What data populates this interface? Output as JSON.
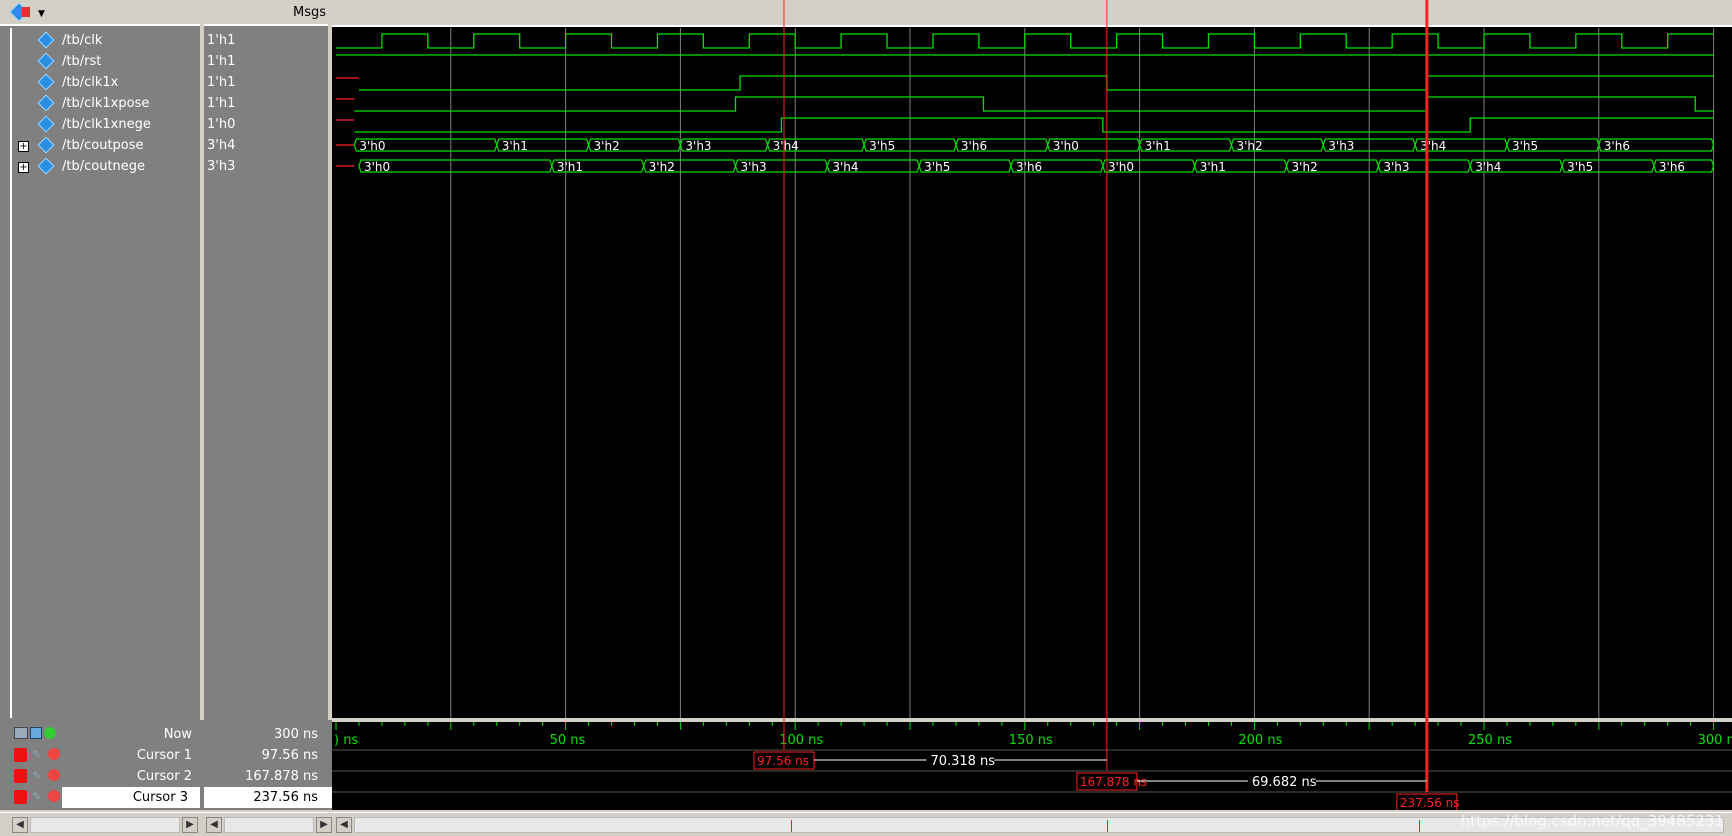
{
  "header": {
    "msgs_label": "Msgs"
  },
  "signals": [
    {
      "name": "/tb/clk",
      "value": "1'h1",
      "expandable": false
    },
    {
      "name": "/tb/rst",
      "value": "1'h1",
      "expandable": false
    },
    {
      "name": "/tb/clk1x",
      "value": "1'h1",
      "expandable": false
    },
    {
      "name": "/tb/clk1xpose",
      "value": "1'h1",
      "expandable": false
    },
    {
      "name": "/tb/clk1xnege",
      "value": "1'h0",
      "expandable": false
    },
    {
      "name": "/tb/coutpose",
      "value": "3'h4",
      "expandable": true
    },
    {
      "name": "/tb/coutnege",
      "value": "3'h3",
      "expandable": true
    }
  ],
  "now": {
    "label": "Now",
    "value": "300 ns"
  },
  "cursors": [
    {
      "label": "Cursor 1",
      "value": "97.56 ns"
    },
    {
      "label": "Cursor 2",
      "value": "167.878 ns"
    },
    {
      "label": "Cursor 3",
      "value": "237.56 ns"
    }
  ],
  "time_axis": {
    "ticks": [
      ") ns",
      "50 ns",
      "100 ns",
      "150 ns",
      "200 ns",
      "250 ns",
      "300 ns"
    ]
  },
  "deltas": [
    "70.318 ns",
    "69.682 ns"
  ],
  "bus_coutpose": [
    "3'h0",
    "3'h1",
    "3'h2",
    "3'h3",
    "3'h4",
    "3'h5",
    "3'h6",
    "3'h0",
    "3'h1",
    "3'h2",
    "3'h3",
    "3'h4",
    "3'h5",
    "3'h6"
  ],
  "bus_coutnege": [
    "3'h0",
    "3'h1",
    "3'h2",
    "3'h3",
    "3'h4",
    "3'h5",
    "3'h6",
    "3'h0",
    "3'h1",
    "3'h2",
    "3'h3",
    "3'h4",
    "3'h5",
    "3'h6"
  ],
  "watermark": "https://blog.csdn.net/qq_39485231",
  "colors": {
    "wave": "#00e000",
    "cursor": "#ff2020",
    "grid": "#808080",
    "selected_cursor": "#ff0000"
  }
}
